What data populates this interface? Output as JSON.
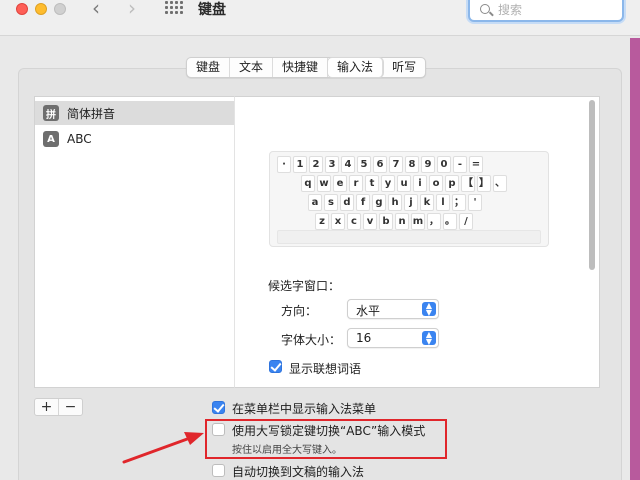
{
  "window": {
    "title": "键盘"
  },
  "search": {
    "placeholder": "搜索"
  },
  "tabs": [
    {
      "label": "键盘"
    },
    {
      "label": "文本"
    },
    {
      "label": "快捷键"
    },
    {
      "label": "输入法",
      "active": true
    },
    {
      "label": "听写"
    }
  ],
  "sources": [
    {
      "icon": "拼",
      "label": "简体拼音",
      "selected": true
    },
    {
      "icon": "A",
      "label": "ABC",
      "selected": false
    }
  ],
  "keyboard": {
    "row1": [
      "·",
      "1",
      "2",
      "3",
      "4",
      "5",
      "6",
      "7",
      "8",
      "9",
      "0",
      "-",
      "="
    ],
    "row2": [
      "q",
      "w",
      "e",
      "r",
      "t",
      "y",
      "u",
      "i",
      "o",
      "p",
      "【",
      "】",
      "、"
    ],
    "row3": [
      "a",
      "s",
      "d",
      "f",
      "g",
      "h",
      "j",
      "k",
      "l",
      "；",
      "'"
    ],
    "row4": [
      "z",
      "x",
      "c",
      "v",
      "b",
      "n",
      "m",
      "，",
      "。",
      "/"
    ]
  },
  "candidate": {
    "title": "候选字窗口：",
    "orientation_label": "方向：",
    "orientation_value": "水平",
    "font_size_label": "字体大小：",
    "font_size_value": "16",
    "predictive_label": "显示联想词语",
    "predictive_checked": true
  },
  "options": {
    "menu_bar_label": "在菜单栏中显示输入法菜单",
    "menu_bar_checked": true,
    "caps_lock_label": "使用大写锁定键切换“ABC”输入模式",
    "caps_lock_hint": "按住以启用全大写键入。",
    "caps_lock_checked": false,
    "auto_switch_label": "自动切换到文稿的输入法",
    "auto_switch_checked": false
  },
  "list_controls": {
    "add": "+",
    "remove": "−"
  },
  "colors": {
    "accent": "#3a84f0",
    "annotation": "#e0262b"
  }
}
